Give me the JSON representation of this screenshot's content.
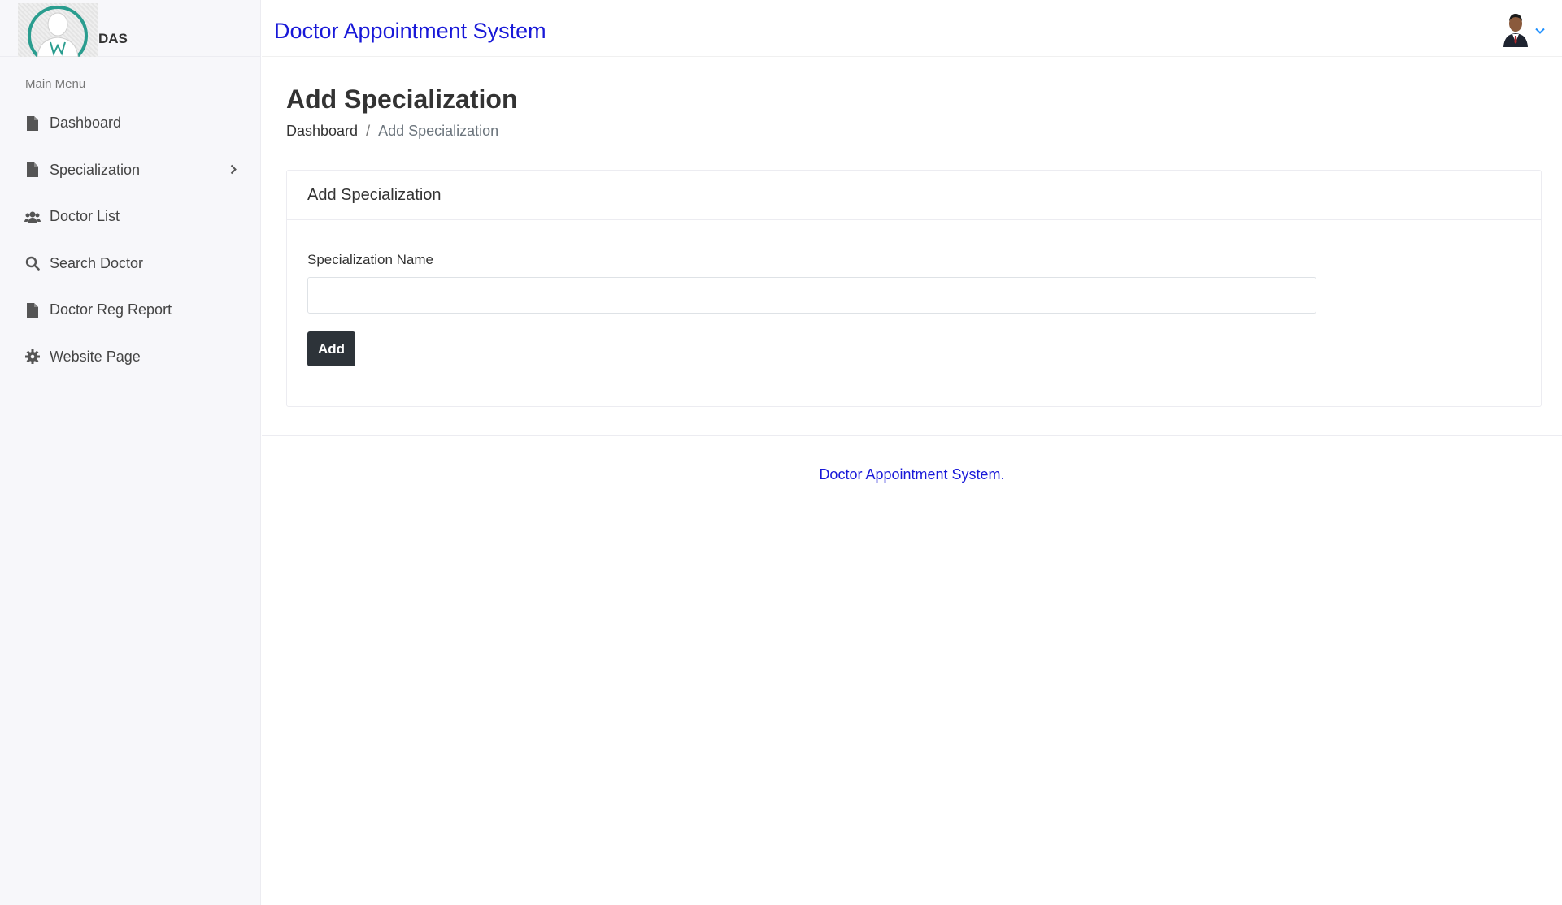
{
  "brand": {
    "logo_alt": "doctor-logo",
    "text": "DAS"
  },
  "header": {
    "title": "Doctor Appointment System"
  },
  "sidebar": {
    "menu_title": "Main Menu",
    "items": [
      {
        "label": "Dashboard",
        "icon": "file-icon"
      },
      {
        "label": "Specialization",
        "icon": "file-icon",
        "has_submenu": true
      },
      {
        "label": "Doctor List",
        "icon": "users-icon"
      },
      {
        "label": "Search Doctor",
        "icon": "search-icon"
      },
      {
        "label": "Doctor Reg Report",
        "icon": "file-icon"
      },
      {
        "label": "Website Page",
        "icon": "gear-icon"
      }
    ]
  },
  "page": {
    "title": "Add Specialization",
    "breadcrumb": {
      "root": "Dashboard",
      "separator": "/",
      "current": "Add Specialization"
    }
  },
  "card": {
    "title": "Add Specialization",
    "field_label": "Specialization Name",
    "field_value": "",
    "button_label": "Add"
  },
  "footer": {
    "text": "Doctor Appointment System."
  },
  "colors": {
    "brand_blue": "#1818d8",
    "button_dark": "#2d3339",
    "teal": "#2a9d8f"
  }
}
